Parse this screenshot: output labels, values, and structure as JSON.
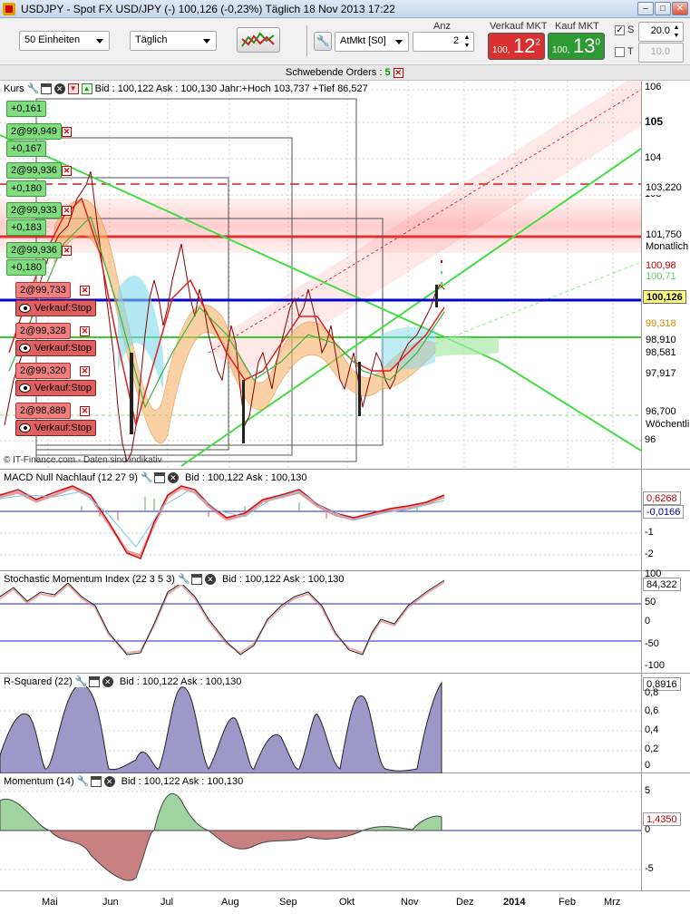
{
  "window": {
    "title": "USDJPY - Spot FX USD/JPY (-)   100,126 (-0,23%)   Täglich  18 Nov 2013 17:22",
    "minimize_label": "–",
    "maximize_label": "□",
    "close_label": "✕"
  },
  "toolbar": {
    "units_select": "50 Einheiten",
    "period_select": "Täglich",
    "order_type_select": "AtMkt [S0]",
    "qty_label": "Anz",
    "qty_value": "2",
    "sell": {
      "label": "Verkauf MKT",
      "small": "100,",
      "big": "12",
      "sup": "2",
      "color": "#d9312f"
    },
    "buy": {
      "label": "Kauf MKT",
      "small": "100,",
      "big": "13",
      "sup": "0",
      "color": "#2e9a34"
    },
    "s_label": "S",
    "s_value": "20.0",
    "t_label": "T",
    "t_value": "10.0",
    "s_checked": true,
    "t_checked": false
  },
  "orders_bar": {
    "label": "Schwebende Orders : ",
    "count": "5"
  },
  "price_panel": {
    "header": "Bid : 100,122 Ask : 100,130 Jahr:+Hoch 103,737 +Tief 86,527",
    "label": "Kurs",
    "watermark": "© IT-Finance.com - Daten sind indikativ",
    "axis": [
      "106",
      "105",
      "104",
      "103",
      "96"
    ],
    "price_tags": [
      {
        "text": "103,220",
        "color": "#ffffff",
        "text_color": "#000"
      },
      {
        "text": "101,750",
        "color": "#ffffff",
        "text_color": "#000"
      },
      {
        "text": "Monatlich",
        "color": "#ffffff",
        "text_color": "#000"
      },
      {
        "text": "100,98",
        "color": "#ffffff",
        "text_color": "#c00000"
      },
      {
        "text": "100,71",
        "color": "#ffffff",
        "text_color": "#66cc66"
      },
      {
        "text": "100,126",
        "color": "#ffff80",
        "text_color": "#000"
      },
      {
        "text": "99,318",
        "color": "#ffffff",
        "text_color": "#e08000"
      },
      {
        "text": "98,910",
        "color": "#ffffff",
        "text_color": "#000"
      },
      {
        "text": "98,581",
        "color": "#ffffff",
        "text_color": "#000"
      },
      {
        "text": "97,917",
        "color": "#ffffff",
        "text_color": "#000"
      },
      {
        "text": "96,700",
        "color": "#ffffff",
        "text_color": "#000"
      },
      {
        "text": "Wöchentli",
        "color": "#ffffff",
        "text_color": "#000"
      }
    ],
    "order_tags": [
      {
        "text": "+0,161",
        "kind": "green"
      },
      {
        "text": "2@99,949",
        "kind": "green",
        "x": true
      },
      {
        "text": "+0,167",
        "kind": "green"
      },
      {
        "text": "2@99,936",
        "kind": "green",
        "x": true
      },
      {
        "text": "+0,180",
        "kind": "green"
      },
      {
        "text": "2@99,933",
        "kind": "green",
        "x": true
      },
      {
        "text": "+0,183",
        "kind": "green"
      },
      {
        "text": "2@99,936",
        "kind": "green",
        "x": true
      },
      {
        "text": "+0,180",
        "kind": "green"
      },
      {
        "text": "2@99,733",
        "kind": "red",
        "x": true
      },
      {
        "text": "Verkauf:Stop",
        "kind": "sell"
      },
      {
        "text": "2@99,328",
        "kind": "red",
        "x": true
      },
      {
        "text": "Verkauf:Stop",
        "kind": "sell"
      },
      {
        "text": "2@99,320",
        "kind": "red",
        "x": true
      },
      {
        "text": "Verkauf:Stop",
        "kind": "sell"
      },
      {
        "text": "2@98,889",
        "kind": "red",
        "x": true
      },
      {
        "text": "Verkauf:Stop",
        "kind": "sell"
      }
    ]
  },
  "macd_panel": {
    "header": "MACD Null Nachlauf (12 27 9)",
    "quote": "Bid : 100,122 Ask : 100,130",
    "axis": [
      "-1",
      "-2"
    ],
    "values": [
      "0,6268",
      "-0,0166"
    ]
  },
  "smi_panel": {
    "header": "Stochastic Momentum Index (22 3 5 3)",
    "quote": "Bid : 100,122 Ask : 100,130",
    "axis": [
      "100",
      "50",
      "0",
      "-50",
      "-100"
    ],
    "value": "84,322"
  },
  "rsq_panel": {
    "header": "R-Squared (22)",
    "quote": "Bid : 100,122 Ask : 100,130",
    "axis": [
      "0,8",
      "0,6",
      "0,4",
      "0,2",
      "0"
    ],
    "value": "0,8916"
  },
  "mom_panel": {
    "header": "Momentum (14)",
    "quote": "Bid : 100,122 Ask : 100,130",
    "axis": [
      "5",
      "0",
      "-5"
    ],
    "value": "1,4350"
  },
  "date_axis": [
    "Mai",
    "Jun",
    "Jul",
    "Aug",
    "Sep",
    "Okt",
    "Nov",
    "Dez",
    "2014",
    "Feb",
    "Mrz"
  ]
}
